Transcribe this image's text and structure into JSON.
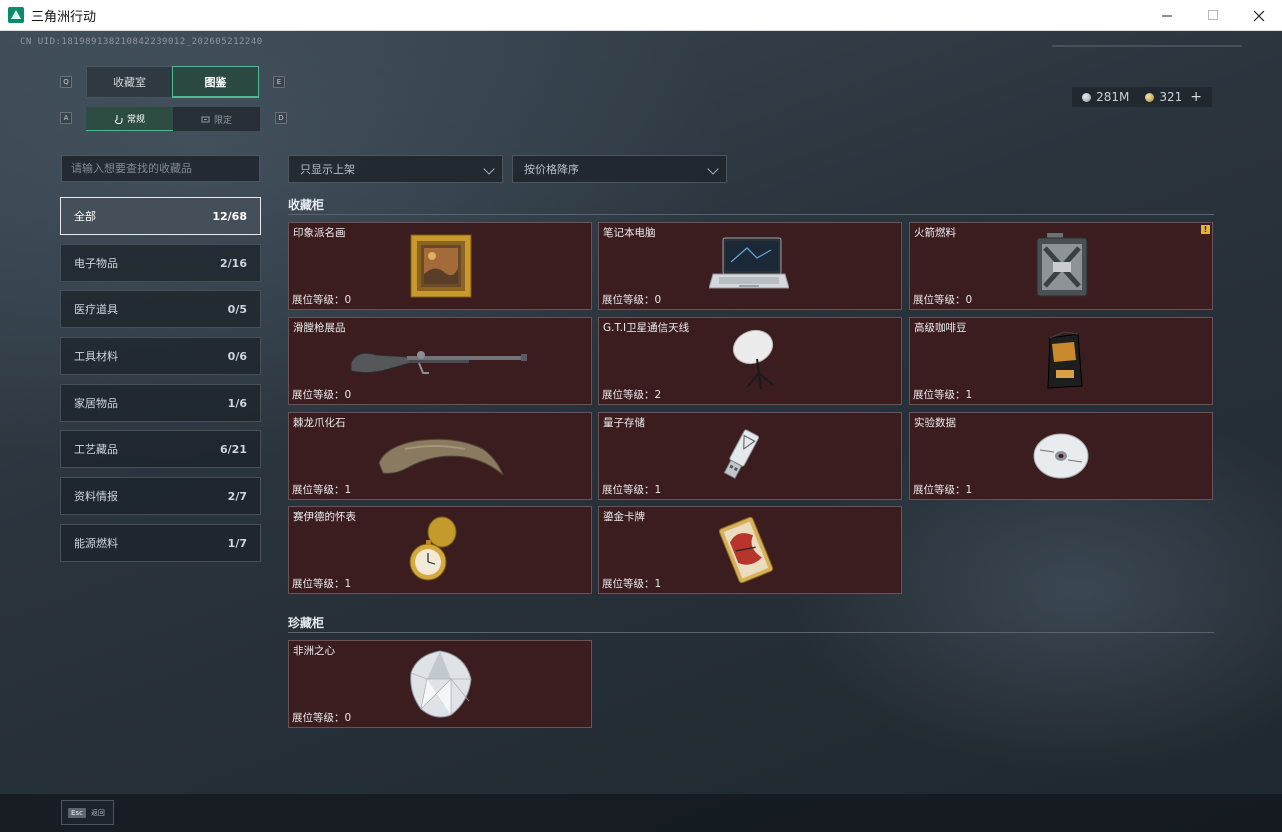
{
  "window": {
    "title": "三角洲行动",
    "minimize_icon": "minimize-icon",
    "maximize_icon": "maximize-icon",
    "close_icon": "close-icon"
  },
  "header": {
    "uid": "CN UID:1819891382108422390​12_202605212240",
    "currency": [
      {
        "icon": "silver-coin-icon",
        "value": "281M"
      },
      {
        "icon": "gold-coin-icon",
        "value": "321"
      }
    ],
    "add_label": "+"
  },
  "tabs": {
    "key_left": "Q",
    "key_right": "E",
    "items": [
      {
        "label": "收藏室",
        "active": false
      },
      {
        "label": "图鉴",
        "active": true
      }
    ]
  },
  "subtabs": {
    "key_left": "A",
    "key_right": "D",
    "items": [
      {
        "label": "常规",
        "icon": "hand-icon",
        "active": true
      },
      {
        "label": "限定",
        "icon": "badge-icon",
        "active": false
      }
    ]
  },
  "search": {
    "placeholder": "请输入想要查找的收藏品",
    "value": ""
  },
  "filters": {
    "show_filter": "只显示上架",
    "sort_filter": "按价格降序"
  },
  "categories": [
    {
      "label": "全部",
      "count": "12/68",
      "selected": true
    },
    {
      "label": "电子物品",
      "count": "2/16",
      "selected": false
    },
    {
      "label": "医疗道具",
      "count": "0/5",
      "selected": false
    },
    {
      "label": "工具材料",
      "count": "0/6",
      "selected": false
    },
    {
      "label": "家居物品",
      "count": "1/6",
      "selected": false
    },
    {
      "label": "工艺藏品",
      "count": "6/21",
      "selected": false
    },
    {
      "label": "资料情报",
      "count": "2/7",
      "selected": false
    },
    {
      "label": "能源燃料",
      "count": "1/7",
      "selected": false
    }
  ],
  "sections": [
    {
      "title": "收藏柜",
      "items": [
        {
          "name": "印象派名画",
          "level": "展位等级：0",
          "icon": "painting-icon"
        },
        {
          "name": "笔记本电脑",
          "level": "展位等级：0",
          "icon": "laptop-icon"
        },
        {
          "name": "火箭燃料",
          "level": "展位等级：0",
          "icon": "fuel-canister-icon",
          "alert": "!"
        },
        {
          "name": "滑膛枪展品",
          "level": "展位等级：0",
          "icon": "musket-icon"
        },
        {
          "name": "G.T.I卫星通信天线",
          "level": "展位等级：2",
          "icon": "satellite-dish-icon"
        },
        {
          "name": "高级咖啡豆",
          "level": "展位等级：1",
          "icon": "coffee-bag-icon"
        },
        {
          "name": "棘龙爪化石",
          "level": "展位等级：1",
          "icon": "claw-fossil-icon"
        },
        {
          "name": "量子存储",
          "level": "展位等级：1",
          "icon": "usb-drive-icon"
        },
        {
          "name": "实验数据",
          "level": "展位等级：1",
          "icon": "disc-icon"
        },
        {
          "name": "赛伊德的怀表",
          "level": "展位等级：1",
          "icon": "pocket-watch-icon"
        },
        {
          "name": "鎏金卡牌",
          "level": "展位等级：1",
          "icon": "gold-card-icon"
        }
      ]
    },
    {
      "title": "珍藏柜",
      "items": [
        {
          "name": "非洲之心",
          "level": "展位等级：0",
          "icon": "diamond-icon"
        }
      ]
    }
  ],
  "footer": {
    "esc_key": "Esc",
    "back_label": "返回"
  }
}
